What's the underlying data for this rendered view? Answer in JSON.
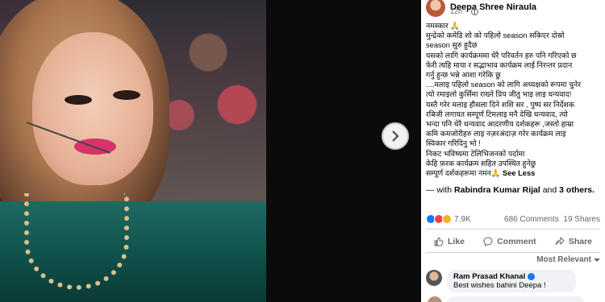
{
  "post": {
    "author": "Deepa Shree Niraula",
    "time": "12h",
    "text_lines": [
      "नमस्कार 🙏",
      "मुन्द्रेको कमेडि शो को पहिलो season सकिएर दोस्रो",
      "season सुरु हुदैछ",
      "यसको लागि कार्यक्रममा धेरै परिवर्तन हरु पनि गरिएको छ",
      "फेरी त्यहि माया र सद्भाभाव कार्यक्रम लाई निरन्तर प्रदान",
      "गर्नु हुन्छ भन्ने आशा गरेकि छु",
      "....मलाइ पहिलो season को लागि अध्यक्षको रूपमा चुनेर",
      "त्यो रमाइलो कुर्सिमा राख्ने प्रिय जीतु भाइ लाइ धन्यवाद!",
      "यस्तै गरेर मलाइ हौसला दिने शशि सर , पुष्प सर निर्देशक",
      "रबिजी लगायत सम्पूर्ण टिमलाइ मनै देखि धन्यवाद, त्यो",
      "भन्दा पनि धेरै धन्यवाद आदरणीय दर्शकहरू ,जस्तो हाम्रा",
      "कमि कमजोरीहरु लाइ नज़रअंदाज़ गरेर कार्यक्रम लाइ",
      "स्विकार गरिदिनु भो !",
      "निकट भविष्यमा टेलिभिजनको पर्दामा",
      "केहि फ़रक कार्यक्रम सहित उपस्थित हुनेछु",
      "सम्पूर्ण दर्शकहरूमा नमन🙏"
    ],
    "see_less": "See Less",
    "tagged_prefix": "— with ",
    "tagged_name": "Rabindra Kumar Rijal",
    "tagged_and": " and ",
    "tagged_others": "3 others."
  },
  "stats": {
    "reactions": "7.9K",
    "comments": "686 Comments",
    "shares": "19 Shares"
  },
  "actions": {
    "like": "Like",
    "comment": "Comment",
    "share": "Share"
  },
  "comments": {
    "sort_label": "Most Relevant",
    "items": [
      {
        "name": "Ram Prasad Khanal",
        "text": "Best wishes bahini Deepa !"
      }
    ]
  },
  "colors": {
    "link_blue": "#1877f2",
    "secondary_text": "#65676b",
    "divider": "#ced0d4"
  }
}
